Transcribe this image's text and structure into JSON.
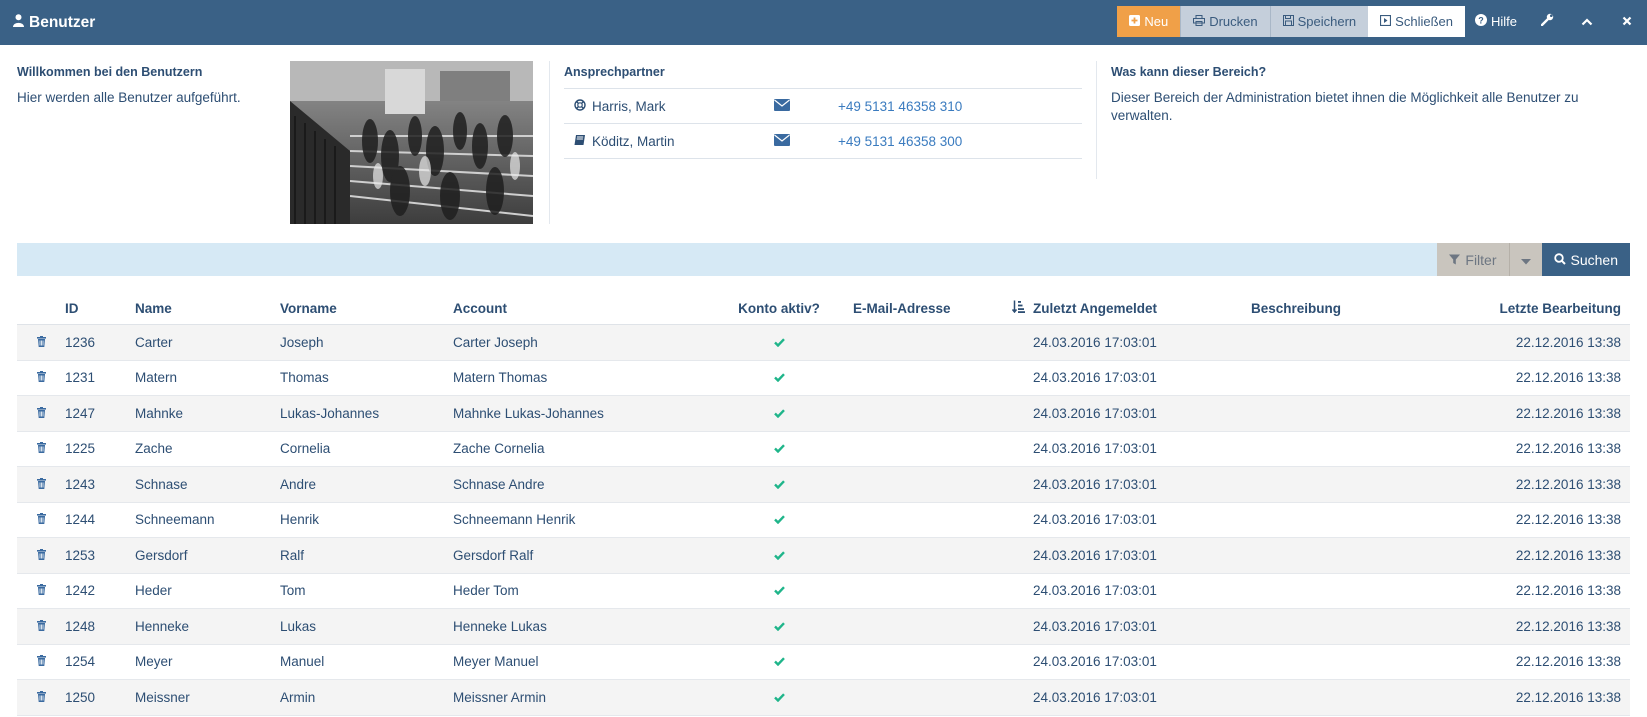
{
  "header": {
    "title": "Benutzer",
    "buttons": {
      "new": "Neu",
      "print": "Drucken",
      "save": "Speichern",
      "close": "Schließen",
      "help": "Hilfe"
    }
  },
  "welcome": {
    "title": "Willkommen bei den Benutzern",
    "text": "Hier werden alle Benutzer aufgeführt."
  },
  "contacts": {
    "title": "Ansprechpartner",
    "items": [
      {
        "name": "Harris, Mark",
        "icon": "lifebuoy-icon",
        "phone": "+49 5131 46358 310"
      },
      {
        "name": "Köditz, Martin",
        "icon": "book-icon",
        "phone": "+49 5131 46358 300"
      }
    ]
  },
  "about": {
    "title": "Was kann dieser Bereich?",
    "text": "Dieser Bereich der Administration bietet ihnen die Möglichkeit alle Benutzer zu verwalten."
  },
  "filterbar": {
    "filter_label": "Filter",
    "search_label": "Suchen"
  },
  "table": {
    "columns": {
      "id": "ID",
      "name": "Name",
      "vorname": "Vorname",
      "account": "Account",
      "aktiv": "Konto aktiv?",
      "email": "E-Mail-Adresse",
      "last_login": "Zuletzt Angemeldet",
      "beschreibung": "Beschreibung",
      "letzte_bearbeitung": "Letzte Bearbeitung"
    },
    "rows": [
      {
        "id": "1236",
        "name": "Carter",
        "vorname": "Joseph",
        "account": "Carter Joseph",
        "last_login": "24.03.2016 17:03:01",
        "edited": "22.12.2016 13:38"
      },
      {
        "id": "1231",
        "name": "Matern",
        "vorname": "Thomas",
        "account": "Matern Thomas",
        "last_login": "24.03.2016 17:03:01",
        "edited": "22.12.2016 13:38"
      },
      {
        "id": "1247",
        "name": "Mahnke",
        "vorname": "Lukas-Johannes",
        "account": "Mahnke Lukas-Johannes",
        "last_login": "24.03.2016 17:03:01",
        "edited": "22.12.2016 13:38"
      },
      {
        "id": "1225",
        "name": "Zache",
        "vorname": "Cornelia",
        "account": "Zache Cornelia",
        "last_login": "24.03.2016 17:03:01",
        "edited": "22.12.2016 13:38"
      },
      {
        "id": "1243",
        "name": "Schnase",
        "vorname": "Andre",
        "account": "Schnase Andre",
        "last_login": "24.03.2016 17:03:01",
        "edited": "22.12.2016 13:38"
      },
      {
        "id": "1244",
        "name": "Schneemann",
        "vorname": "Henrik",
        "account": "Schneemann Henrik",
        "last_login": "24.03.2016 17:03:01",
        "edited": "22.12.2016 13:38"
      },
      {
        "id": "1253",
        "name": "Gersdorf",
        "vorname": "Ralf",
        "account": "Gersdorf Ralf",
        "last_login": "24.03.2016 17:03:01",
        "edited": "22.12.2016 13:38"
      },
      {
        "id": "1242",
        "name": "Heder",
        "vorname": "Tom",
        "account": "Heder Tom",
        "last_login": "24.03.2016 17:03:01",
        "edited": "22.12.2016 13:38"
      },
      {
        "id": "1248",
        "name": "Henneke",
        "vorname": "Lukas",
        "account": "Henneke Lukas",
        "last_login": "24.03.2016 17:03:01",
        "edited": "22.12.2016 13:38"
      },
      {
        "id": "1254",
        "name": "Meyer",
        "vorname": "Manuel",
        "account": "Meyer Manuel",
        "last_login": "24.03.2016 17:03:01",
        "edited": "22.12.2016 13:38"
      },
      {
        "id": "1250",
        "name": "Meissner",
        "vorname": "Armin",
        "account": "Meissner Armin",
        "last_login": "24.03.2016 17:03:01",
        "edited": "22.12.2016 13:38"
      }
    ]
  },
  "colors": {
    "header_bg": "#3a6186",
    "accent_orange": "#f0a048",
    "filter_bar_bg": "#d6e9f5",
    "check_green": "#1fb58a"
  }
}
